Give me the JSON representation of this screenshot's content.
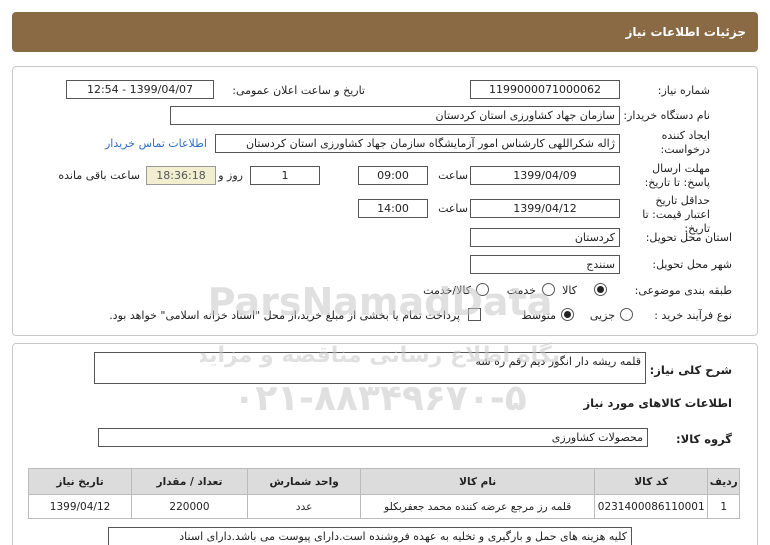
{
  "header": {
    "title": "جزئیات اطلاعات نیاز"
  },
  "form": {
    "need_number_label": "شماره نیاز:",
    "need_number": "1199000071000062",
    "announce_label": "تاریخ و ساعت اعلان عمومی:",
    "announce_value": "1399/04/07 - 12:54",
    "buyer_label": "نام دستگاه خریدار:",
    "buyer_value": "سازمان جهاد کشاورزی استان کردستان",
    "creator_label": "ایجاد کننده درخواست:",
    "creator_value": "ژاله شکراللهی کارشناس امور آزمایشگاه سازمان جهاد کشاورزی استان کردستان",
    "contact_link": "اطلاعات تماس خریدار",
    "deadline_label": "مهلت ارسال پاسخ: تا تاریخ:",
    "deadline_date": "1399/04/09",
    "time_label": "ساعت",
    "deadline_time": "09:00",
    "days_value": "1",
    "days_label": "روز و",
    "remaining_time": "18:36:18",
    "remaining_label": "ساعت باقی مانده",
    "validity_label": "حداقل تاریخ اعتبار قیمت: تا تاریخ:",
    "validity_date": "1399/04/12",
    "validity_time": "14:00",
    "province_label": "استان محل تحویل:",
    "province_value": "کردستان",
    "city_label": "شهر محل تحویل:",
    "city_value": "سنندج",
    "category_label": "طبقه بندی موضوعی:",
    "category_options": [
      "کالا",
      "خدمت",
      "کالا/خدمت"
    ],
    "category_selected": "کالا",
    "process_label": "نوع فرآیند خرید :",
    "process_options": [
      "جزیی",
      "متوسط"
    ],
    "process_selected": "متوسط",
    "payment_note": "پرداخت تمام یا بخشی از مبلغ خرید،از محل \"اسناد خزانه اسلامی\" خواهد بود."
  },
  "details": {
    "summary_label": "شرح کلی نیاز:",
    "summary_value": "قلمه ریشه دار انگور دیم رقم ره شه",
    "goods_info_title": "اطلاعات کالاهای مورد نیاز",
    "goods_group_label": "گروه کالا:",
    "goods_group_value": "محصولات کشاورزی",
    "table_headers": [
      "ردیف",
      "کد کالا",
      "نام کالا",
      "واحد شمارش",
      "تعداد / مقدار",
      "تاریخ نیاز"
    ],
    "table_rows": [
      [
        "1",
        "0231400086110001",
        "قلمه رز مرجع عرضه کننده محمد جعفربکلو",
        "عدد",
        "220000",
        "1399/04/12"
      ]
    ],
    "notes_value": "کلیه هزینه های حمل و بارگیری و تخلیه به عهده فروشنده است.دارای پیوست می باشد.دارای اسناد"
  },
  "watermark": {
    "brand": "ParsNamadData",
    "line1": "پایگاه اطلاع رسانی مناقصه و مزایده",
    "phone": "۰۲۱-۸۸۳۴۹۶۷۰-۵"
  },
  "colors": {
    "header_bg": "#8a6a45",
    "link": "#2e6fc4",
    "timer_bg": "#f2efd0"
  }
}
